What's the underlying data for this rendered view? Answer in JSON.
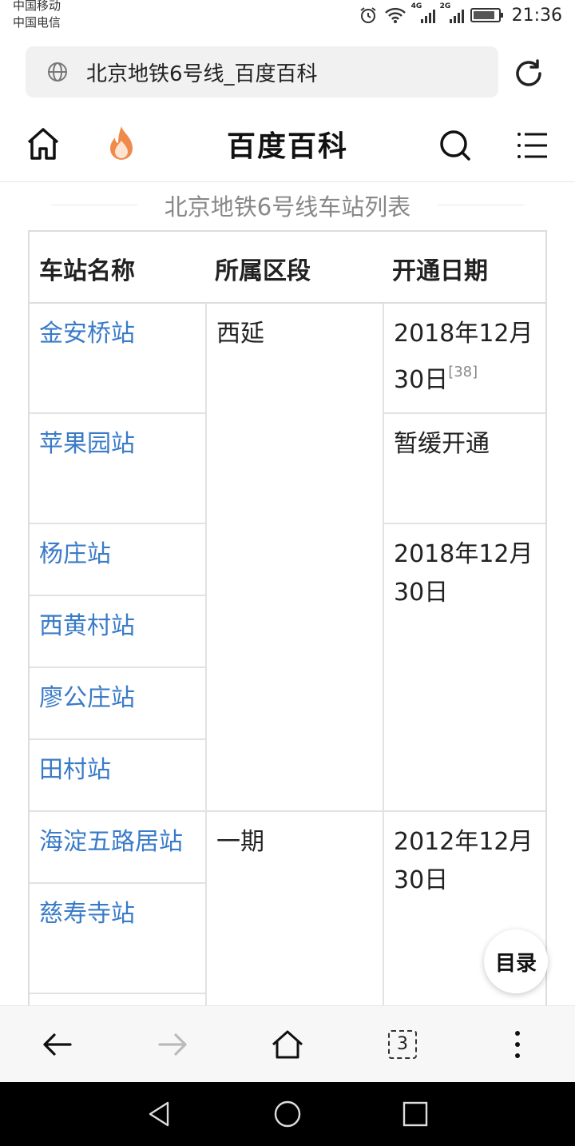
{
  "status_bar": {
    "carrier1": "中国移动",
    "carrier2": "中国电信",
    "net1": "4G",
    "net2": "2G",
    "time": "21:36"
  },
  "url_bar": {
    "text": "北京地铁6号线_百度百科"
  },
  "header": {
    "title": "百度百科"
  },
  "table": {
    "caption": "北京地铁6号线车站列表",
    "headers": [
      "车站名称",
      "所属区段",
      "开通日期"
    ],
    "stations": [
      "金安桥站",
      "苹果园站",
      "杨庄站",
      "西黄村站",
      "廖公庄站",
      "田村站",
      "海淀五路居站",
      "慈寿寺站"
    ],
    "sections": [
      "西延",
      "一期"
    ],
    "dates": [
      "2018年12月30日",
      "暂缓开通",
      "2018年12月30日",
      "2012年12月30日"
    ],
    "ref": "[38]"
  },
  "toc_label": "目录",
  "toolbar": {
    "tab_count": "3"
  },
  "colors": {
    "link": "#3a7bc8",
    "accent_fire": "#f08a4b"
  }
}
